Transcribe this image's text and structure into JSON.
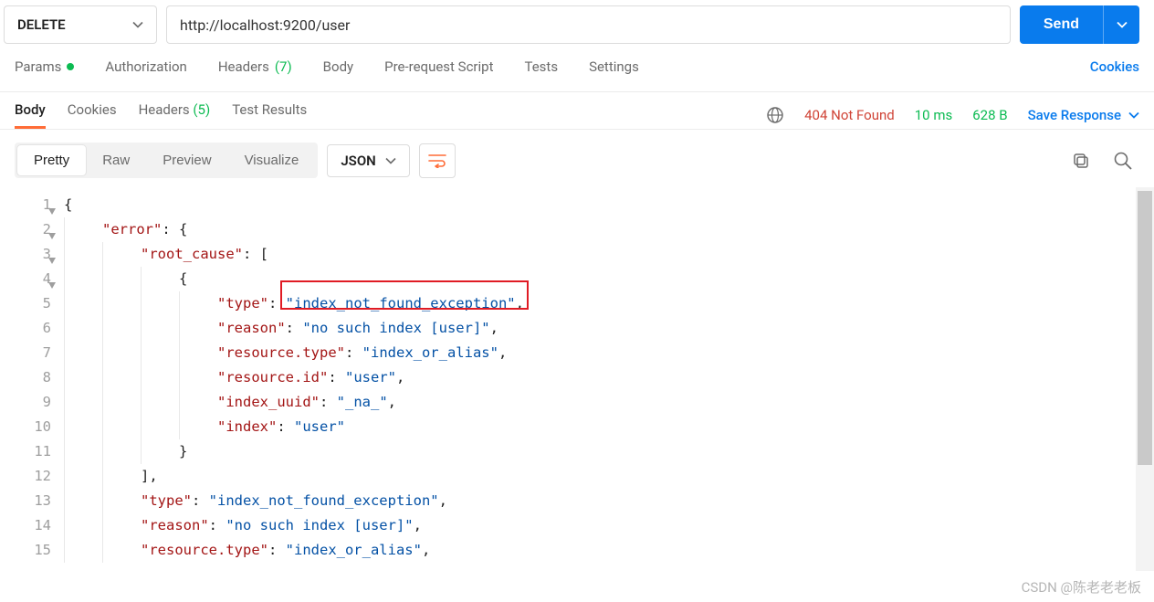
{
  "request": {
    "method": "DELETE",
    "url": "http://localhost:9200/user",
    "send_label": "Send"
  },
  "req_tabs": {
    "params": "Params",
    "authorization": "Authorization",
    "headers": "Headers",
    "headers_count": "(7)",
    "body": "Body",
    "prerequest": "Pre-request Script",
    "tests": "Tests",
    "settings": "Settings",
    "cookies": "Cookies"
  },
  "resp_tabs": {
    "body": "Body",
    "cookies": "Cookies",
    "headers": "Headers",
    "headers_count": "(5)",
    "test_results": "Test Results"
  },
  "status": {
    "code": "404",
    "text": "Not Found",
    "time": "10 ms",
    "size": "628 B",
    "save": "Save Response"
  },
  "body_views": {
    "pretty": "Pretty",
    "raw": "Raw",
    "preview": "Preview",
    "visualize": "Visualize",
    "format": "JSON"
  },
  "code_lines": [
    [
      {
        "t": "punc",
        "v": "{"
      }
    ],
    [
      {
        "ind": 1
      },
      {
        "t": "key",
        "v": "\"error\""
      },
      {
        "t": "punc",
        "v": ": {"
      }
    ],
    [
      {
        "ind": 2
      },
      {
        "t": "key",
        "v": "\"root_cause\""
      },
      {
        "t": "punc",
        "v": ": ["
      }
    ],
    [
      {
        "ind": 3
      },
      {
        "t": "punc",
        "v": "{"
      }
    ],
    [
      {
        "ind": 4
      },
      {
        "t": "key",
        "v": "\"type\""
      },
      {
        "t": "punc",
        "v": ": "
      },
      {
        "t": "str",
        "hl": true,
        "v": "\"index_not_found_exception\""
      },
      {
        "t": "punc",
        "v": ","
      }
    ],
    [
      {
        "ind": 4
      },
      {
        "t": "key",
        "v": "\"reason\""
      },
      {
        "t": "punc",
        "v": ": "
      },
      {
        "t": "str",
        "v": "\"no such index [user]\""
      },
      {
        "t": "punc",
        "v": ","
      }
    ],
    [
      {
        "ind": 4
      },
      {
        "t": "key",
        "v": "\"resource.type\""
      },
      {
        "t": "punc",
        "v": ": "
      },
      {
        "t": "str",
        "v": "\"index_or_alias\""
      },
      {
        "t": "punc",
        "v": ","
      }
    ],
    [
      {
        "ind": 4
      },
      {
        "t": "key",
        "v": "\"resource.id\""
      },
      {
        "t": "punc",
        "v": ": "
      },
      {
        "t": "str",
        "v": "\"user\""
      },
      {
        "t": "punc",
        "v": ","
      }
    ],
    [
      {
        "ind": 4
      },
      {
        "t": "key",
        "v": "\"index_uuid\""
      },
      {
        "t": "punc",
        "v": ": "
      },
      {
        "t": "str",
        "v": "\"_na_\""
      },
      {
        "t": "punc",
        "v": ","
      }
    ],
    [
      {
        "ind": 4
      },
      {
        "t": "key",
        "v": "\"index\""
      },
      {
        "t": "punc",
        "v": ": "
      },
      {
        "t": "str",
        "v": "\"user\""
      }
    ],
    [
      {
        "ind": 3
      },
      {
        "t": "punc",
        "v": "}"
      }
    ],
    [
      {
        "ind": 2
      },
      {
        "t": "punc",
        "v": "],"
      }
    ],
    [
      {
        "ind": 2
      },
      {
        "t": "key",
        "v": "\"type\""
      },
      {
        "t": "punc",
        "v": ": "
      },
      {
        "t": "str",
        "v": "\"index_not_found_exception\""
      },
      {
        "t": "punc",
        "v": ","
      }
    ],
    [
      {
        "ind": 2
      },
      {
        "t": "key",
        "v": "\"reason\""
      },
      {
        "t": "punc",
        "v": ": "
      },
      {
        "t": "str",
        "v": "\"no such index [user]\""
      },
      {
        "t": "punc",
        "v": ","
      }
    ],
    [
      {
        "ind": 2
      },
      {
        "t": "key",
        "v": "\"resource.type\""
      },
      {
        "t": "punc",
        "v": ": "
      },
      {
        "t": "str",
        "v": "\"index_or_alias\""
      },
      {
        "t": "punc",
        "v": ","
      }
    ]
  ],
  "watermark": "CSDN @陈老老老板"
}
